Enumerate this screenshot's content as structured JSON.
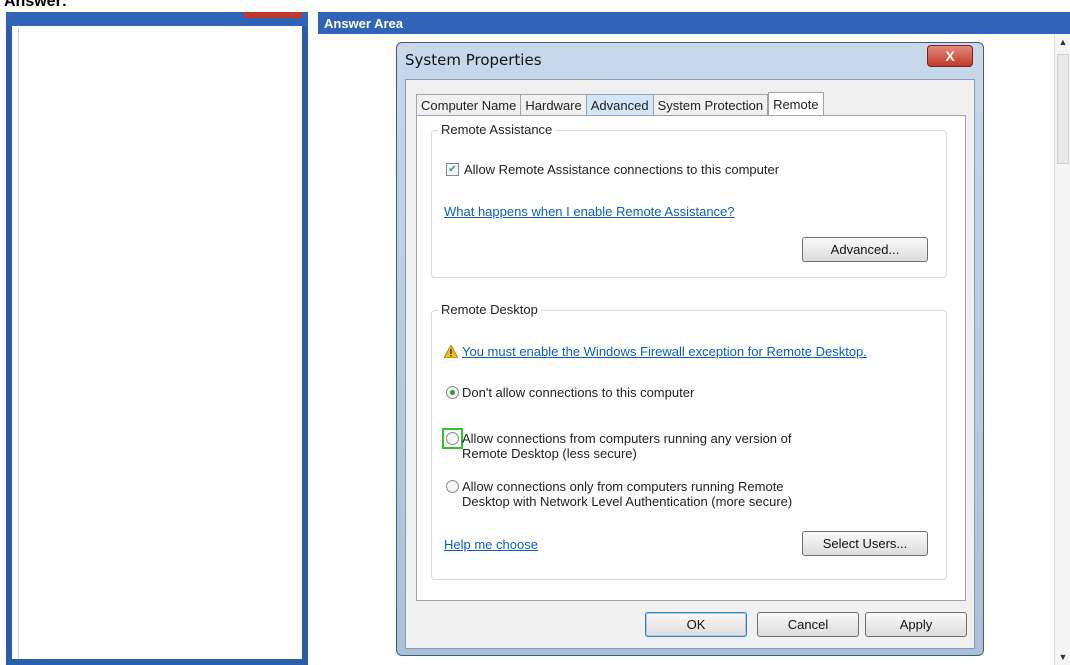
{
  "page": {
    "header": "Answer:"
  },
  "answer_area": {
    "title": "Answer Area"
  },
  "dialog": {
    "title": "System Properties",
    "close_label": "X",
    "tabs": [
      {
        "label": "Computer Name",
        "state": "normal"
      },
      {
        "label": "Hardware",
        "state": "normal"
      },
      {
        "label": "Advanced",
        "state": "highlighted"
      },
      {
        "label": "System Protection",
        "state": "normal"
      },
      {
        "label": "Remote",
        "state": "active"
      }
    ],
    "remote_assistance": {
      "title": "Remote Assistance",
      "allow_label": "Allow Remote Assistance connections to this computer",
      "allow_checked": true,
      "help_link": "What happens when I enable Remote Assistance?",
      "advanced_button": "Advanced..."
    },
    "remote_desktop": {
      "title": "Remote Desktop",
      "warning_link": "You must enable the Windows Firewall exception for Remote Desktop.",
      "options": [
        {
          "line1": "Don't allow connections to this computer",
          "line2": "",
          "selected": true
        },
        {
          "line1": "Allow connections from computers running any version of",
          "line2": "Remote Desktop (less secure)",
          "selected": false,
          "highlighted": true
        },
        {
          "line1": "Allow connections only from computers running Remote",
          "line2": "Desktop with Network Level Authentication (more secure)",
          "selected": false
        }
      ],
      "help_link": "Help me choose",
      "select_users_button": "Select Users..."
    },
    "buttons": {
      "ok": "OK",
      "cancel": "Cancel",
      "apply": "Apply"
    }
  },
  "colors": {
    "header_blue": "#2f64b8",
    "close_red": "#c0392b",
    "highlight_green": "#2fc32f",
    "link_blue": "#0b5fb8"
  }
}
